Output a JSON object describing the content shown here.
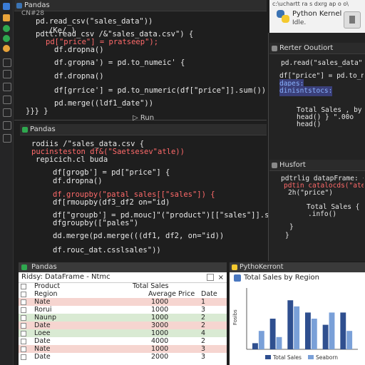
{
  "window": {
    "top_strip_code": "c:\\uchartt ra s dxrg ap o o\\",
    "kernel_title": "Python Kernel",
    "kernel_status": "Idle."
  },
  "panel_top": {
    "title": "Pandas",
    "cell_label": "CN#28",
    "lines": [
      "pd.read_csv(\"sales_data\"))",
      "/Ke/ )",
      "pdtt.read_csv /&\"sales_data.csv\") {",
      "pd[\"price\"] = pratseep\");",
      "df.dropna()",
      "df.gropna') = pd.to_numeic' {",
      "df.dropna()",
      "df[grrice'] = pd.to_numeric(df[\"price\"]].sum())",
      "pd.merge((ldf1_date\"))",
      "}}} }"
    ],
    "run_label": "▷ Run"
  },
  "panel_mid": {
    "title": "Pandas",
    "lines": [
      "rodiis /\"sales_data.csv {",
      "pucinsteston df&(\"Saetsesev\"atle))",
      "repicich.cl buda",
      "df[grogb'] = pd[\"price\"] {",
      "df.dropna()",
      "df.groupby(\"patal sales[[\"sales\"]) {",
      "df[rmoupby(df3_df2 on=\"id)",
      "df[\"groupb'] = pd.mouc]\"(\"product\")[[\"sales\"]].sum())",
      "dfgroupby([\"pales\")",
      "dd.merge(pd.merge(((df1, df2, on=\"id))",
      "df.rouc_dat.csslsales\"))"
    ]
  },
  "panel_right_top": {
    "title": "Rerter Ooutiort",
    "lines": [
      "pd.read(\"sales_data\"))",
      "df[\"price\"] = pd.to_numeric",
      "dapes:",
      "dinisntstocs:",
      "Total Sales , by",
      "head() } \".00o",
      "head()"
    ]
  },
  "panel_right_bottom": {
    "title": "Husfort",
    "lines": [
      "pdtrlig datapFrame: {",
      "pdtin catalocds(\"ater",
      "2h(\"price\")",
      "Total Sales {",
      ".info()",
      "}",
      "}"
    ]
  },
  "table": {
    "header_bar": "Pandas",
    "title": "Ridsy: DataFrame - Ntmc",
    "columns": [
      "Product",
      "Total Sales",
      "Average Price",
      "Date"
    ],
    "subheader": [
      "Region",
      "",
      "Average Price",
      "Date"
    ],
    "rows": [
      {
        "name": "Nate",
        "total": "1000",
        "date": "1",
        "bg": "#f6d5d0"
      },
      {
        "name": "Rorui",
        "total": "1000",
        "date": "3",
        "bg": "#ffffff"
      },
      {
        "name": "Naunp",
        "total": "1000",
        "date": "2",
        "bg": "#d9ead3"
      },
      {
        "name": "Date",
        "total": "3000",
        "date": "2",
        "bg": "#f6d5d0"
      },
      {
        "name": "Loee",
        "total": "1000",
        "date": "4",
        "bg": "#d9ead3"
      },
      {
        "name": "Date",
        "total": "4000",
        "date": "2",
        "bg": "#ffffff"
      },
      {
        "name": "Nate",
        "total": "1000",
        "date": "3",
        "bg": "#f6d5d0"
      },
      {
        "name": "Date",
        "total": "2000",
        "date": "3",
        "bg": "#ffffff"
      }
    ]
  },
  "chart_panel": {
    "tab": "PythoKerront",
    "chart_data": {
      "type": "bar",
      "title": "Total Sales by Region",
      "ylabel": "Fosibs",
      "series": [
        {
          "name": "Total Sales",
          "color": "#2f4f8f",
          "values": [
            1,
            5,
            8,
            6,
            4,
            6
          ]
        },
        {
          "name": "Seaborn",
          "color": "#7aa0d8",
          "values": [
            3,
            2,
            7,
            5,
            6,
            3
          ]
        }
      ],
      "ylim": [
        0,
        10
      ],
      "legend": "bottom",
      "grid": false
    }
  }
}
